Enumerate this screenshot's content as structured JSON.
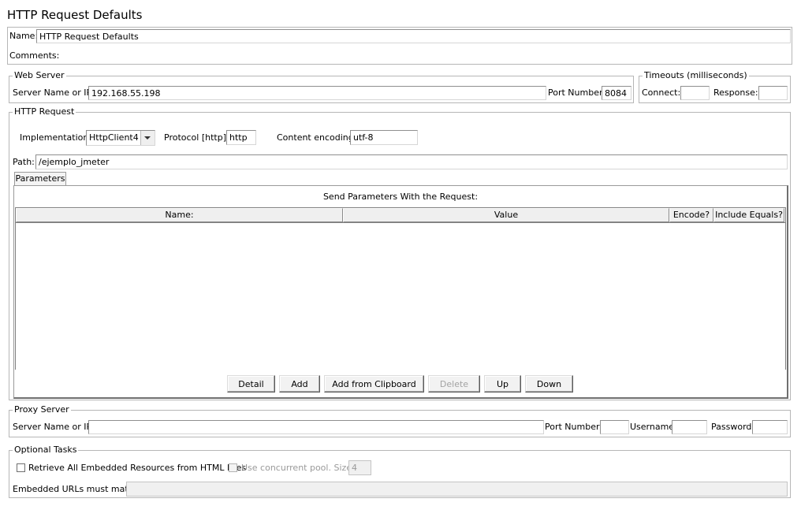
{
  "page_title": "HTTP Request Defaults",
  "name": {
    "label": "Name:",
    "value": "HTTP Request Defaults"
  },
  "comments": {
    "label": "Comments:",
    "value": ""
  },
  "web_server": {
    "legend": "Web Server",
    "server_label": "Server Name or IP:",
    "server_value": "192.168.55.198",
    "port_label": "Port Number:",
    "port_value": "8084"
  },
  "timeouts": {
    "legend": "Timeouts (milliseconds)",
    "connect_label": "Connect:",
    "connect_value": "",
    "response_label": "Response:",
    "response_value": ""
  },
  "http_request": {
    "legend": "HTTP Request",
    "implementation_label": "Implementation:",
    "implementation_value": "HttpClient4",
    "protocol_label": "Protocol [http]:",
    "protocol_value": "http",
    "encoding_label": "Content encoding:",
    "encoding_value": "utf-8",
    "path_label": "Path:",
    "path_value": "/ejemplo_jmeter",
    "tab_parameters": "Parameters",
    "send_params_title": "Send Parameters With the Request:",
    "columns": [
      "Name:",
      "Value",
      "Encode?",
      "Include Equals?"
    ],
    "rows": [],
    "buttons": {
      "detail": "Detail",
      "add": "Add",
      "add_clipboard": "Add from Clipboard",
      "delete": "Delete",
      "up": "Up",
      "down": "Down"
    }
  },
  "proxy": {
    "legend": "Proxy Server",
    "server_label": "Server Name or IP:",
    "server_value": "",
    "port_label": "Port Number:",
    "port_value": "",
    "username_label": "Username",
    "username_value": "",
    "password_label": "Password",
    "password_value": ""
  },
  "optional": {
    "legend": "Optional Tasks",
    "retrieve_label": "Retrieve All Embedded Resources from HTML Files",
    "retrieve_checked": false,
    "concurrent_label": "Use concurrent pool. Size:",
    "concurrent_checked": false,
    "pool_size": "4",
    "embedded_label": "Embedded URLs must match:",
    "embedded_value": ""
  }
}
